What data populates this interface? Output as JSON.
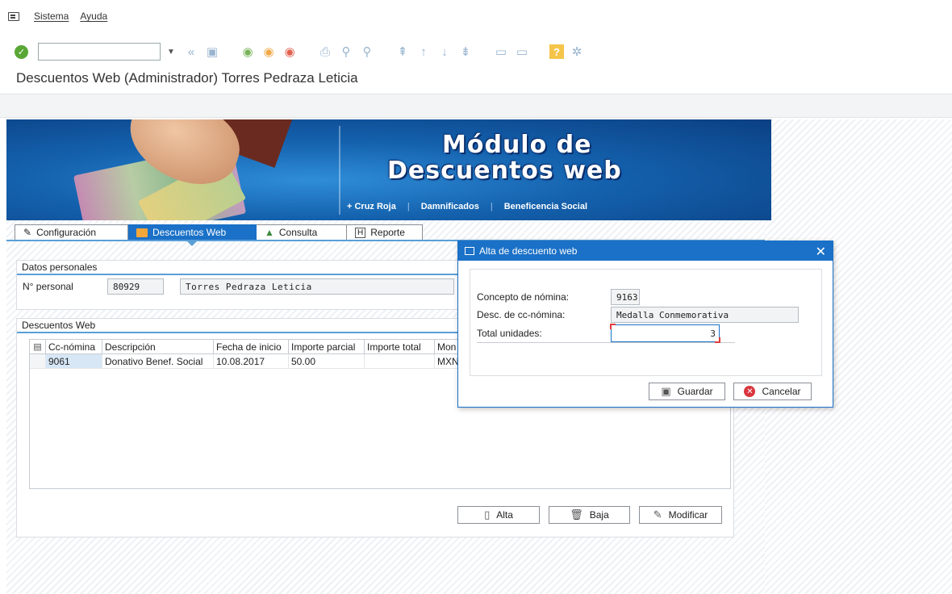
{
  "menu": {
    "items": [
      "Sistema",
      "Ayuda"
    ]
  },
  "toolbar": {
    "command_value": ""
  },
  "page": {
    "title": "Descuentos Web (Administrador) Torres Pedraza Leticia"
  },
  "banner": {
    "line1": "Módulo de",
    "line2": "Descuentos web",
    "tags": [
      "+ Cruz Roja",
      "Damnificados",
      "Beneficencia Social"
    ]
  },
  "tabs": [
    {
      "label": "Configuración",
      "icon": "config-icon"
    },
    {
      "label": "Descuentos Web",
      "icon": "folder-icon"
    },
    {
      "label": "Consulta",
      "icon": "chart-icon"
    },
    {
      "label": "Reporte",
      "icon": "report-icon"
    }
  ],
  "personal": {
    "header": "Datos personales",
    "label": "N° personal",
    "number": "80929",
    "name": "Torres Pedraza Leticia"
  },
  "descuentos": {
    "header": "Descuentos Web",
    "columns": [
      "Cc-nómina",
      "Descripción",
      "Fecha de inicio",
      "Importe parcial",
      "Importe total",
      "Mon"
    ],
    "rows": [
      [
        "9061",
        "Donativo Benef. Social",
        "10.08.2017",
        "50.00",
        "",
        "MXN"
      ]
    ],
    "buttons": {
      "alta": "Alta",
      "baja": "Baja",
      "modificar": "Modificar"
    }
  },
  "dialog": {
    "title": "Alta de descuento web",
    "concepto_label": "Concepto de nómina:",
    "concepto_value": "9163",
    "desc_label": "Desc. de cc-nómina:",
    "desc_value": "Medalla Conmemorativa",
    "total_label": "Total unidades:",
    "total_value": "3",
    "save_label": "Guardar",
    "cancel_label": "Cancelar"
  },
  "colors": {
    "accent": "#1b71c7",
    "tab_active": "#1b71c7",
    "ok_green": "#5aa736",
    "cancel_red": "#d9363e"
  }
}
